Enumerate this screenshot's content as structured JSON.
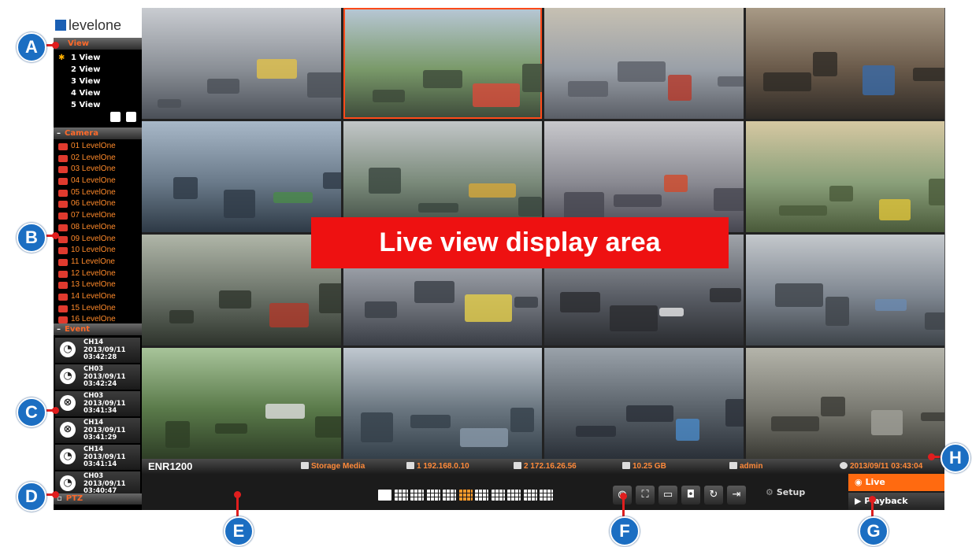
{
  "brand": {
    "logo_text": "levelone"
  },
  "sidebar": {
    "view": {
      "header": "View",
      "items": [
        "1 View",
        "2 View",
        "3 View",
        "4 View",
        "5 View"
      ]
    },
    "camera": {
      "header": "Camera",
      "items": [
        "01 LevelOne",
        "02 LevelOne",
        "03 LevelOne",
        "04 LevelOne",
        "05 LevelOne",
        "06 LevelOne",
        "07 LevelOne",
        "08 LevelOne",
        "09 LevelOne",
        "10 LevelOne",
        "11 LevelOne",
        "12 LevelOne",
        "13 LevelOne",
        "14 LevelOne",
        "15 LevelOne",
        "16 LevelOne"
      ]
    },
    "event": {
      "header": "Event",
      "items": [
        {
          "channel": "CH14",
          "date": "2013/09/11",
          "time": "03:42:28",
          "icon": "motion-icon"
        },
        {
          "channel": "CH03",
          "date": "2013/09/11",
          "time": "03:42:24",
          "icon": "motion-icon"
        },
        {
          "channel": "CH03",
          "date": "2013/09/11",
          "time": "03:41:34",
          "icon": "video-loss-icon"
        },
        {
          "channel": "CH14",
          "date": "2013/09/11",
          "time": "03:41:29",
          "icon": "video-loss-icon"
        },
        {
          "channel": "CH14",
          "date": "2013/09/11",
          "time": "03:41:14",
          "icon": "motion-icon"
        },
        {
          "channel": "CH03",
          "date": "2013/09/11",
          "time": "03:40:47",
          "icon": "motion-icon"
        }
      ]
    },
    "ptz": {
      "header": "PTZ"
    }
  },
  "overlay_label": "Live view display area",
  "status": {
    "device": "ENR1200",
    "storage": "Storage Media",
    "lan1": "1 192.168.0.10",
    "lan2": "2 172.16.26.56",
    "disk": "10.25 GB",
    "user": "admin",
    "datetime": "2013/09/11 03:43:04"
  },
  "toolbar": {
    "setup_label": "Setup",
    "live_label": "Live",
    "playback_label": "Playback",
    "layouts": [
      "1x1",
      "1x2",
      "2x2",
      "2x3",
      "3x3",
      "4x4",
      "1+5",
      "1+7",
      "1+12",
      "2+8",
      "1+9"
    ],
    "selected_layout_index": 5,
    "buttons": [
      "sequence-icon",
      "fullscreen-icon",
      "monitor-icon",
      "snapshot-icon",
      "refresh-icon",
      "logout-icon"
    ]
  },
  "callouts": [
    "A",
    "B",
    "C",
    "D",
    "E",
    "F",
    "G",
    "H"
  ],
  "colors": {
    "accent": "#ff6a10",
    "callout": "#1b6ec2",
    "label_red": "#ee1111"
  }
}
